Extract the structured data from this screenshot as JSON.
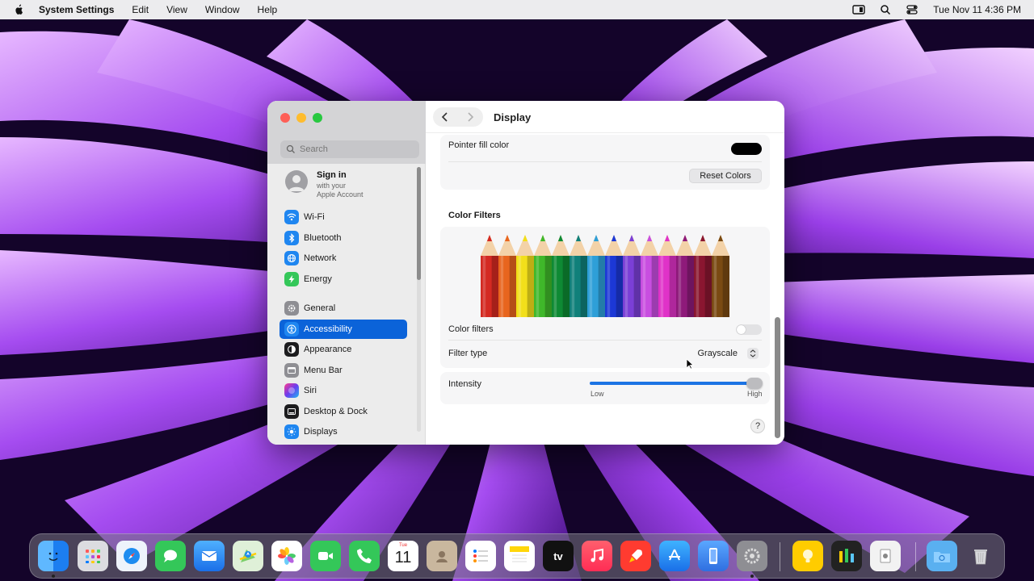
{
  "menubar": {
    "app_name": "System Settings",
    "menus": [
      "Edit",
      "View",
      "Window",
      "Help"
    ],
    "clock": "Tue Nov 11  4:36 PM",
    "status_icons": [
      "display-mirror-icon",
      "search-icon",
      "control-center-icon"
    ]
  },
  "window": {
    "sidebar": {
      "search_placeholder": "Search",
      "account": {
        "title": "Sign in",
        "subtitle_line1": "with your",
        "subtitle_line2": "Apple Account"
      },
      "items": [
        {
          "label": "Wi-Fi",
          "icon": "wifi-icon",
          "color": "#1f86f0"
        },
        {
          "label": "Bluetooth",
          "icon": "bluetooth-icon",
          "color": "#1f86f0"
        },
        {
          "label": "Network",
          "icon": "globe-icon",
          "color": "#1f86f0"
        },
        {
          "label": "Energy",
          "icon": "bolt-icon",
          "color": "#34c759"
        },
        {
          "label": "General",
          "icon": "gear-icon",
          "color": "#8e8e93"
        },
        {
          "label": "Accessibility",
          "icon": "accessibility-icon",
          "color": "#1f86f0",
          "selected": true
        },
        {
          "label": "Appearance",
          "icon": "appearance-icon",
          "color": "#1c1c1e"
        },
        {
          "label": "Menu Bar",
          "icon": "menubar-icon",
          "color": "#8e8e93"
        },
        {
          "label": "Siri",
          "icon": "siri-icon",
          "color": "#6a3df0"
        },
        {
          "label": "Desktop & Dock",
          "icon": "dock-icon",
          "color": "#1c1c1e"
        },
        {
          "label": "Displays",
          "icon": "sun-icon",
          "color": "#1f86f0"
        }
      ]
    },
    "content": {
      "title": "Display",
      "pointer_fill_label": "Pointer fill color",
      "pointer_fill_color": "#000000",
      "reset_button": "Reset Colors",
      "color_filters_section": "Color Filters",
      "color_filters_toggle_label": "Color filters",
      "color_filters_enabled": false,
      "filter_type_label": "Filter type",
      "filter_type_value": "Grayscale",
      "intensity_label": "Intensity",
      "intensity_low": "Low",
      "intensity_high": "High",
      "intensity_value": 1.0,
      "help_label": "?"
    }
  },
  "pencil_colors": [
    "#d42a22",
    "#e8651e",
    "#f2df1a",
    "#3fb82a",
    "#0e8a34",
    "#10807a",
    "#2e9fd8",
    "#1c38d6",
    "#7b3fd6",
    "#c84ee0",
    "#e032c8",
    "#8e1a7a",
    "#8a1630",
    "#7a4a12"
  ],
  "dock": {
    "calendar_month": "Tue",
    "calendar_day": "11",
    "tv_label": "tv",
    "apps": [
      {
        "name": "Finder",
        "icon": "finder-icon"
      },
      {
        "name": "Launchpad",
        "icon": "launchpad-icon"
      },
      {
        "name": "Safari",
        "icon": "safari-icon"
      },
      {
        "name": "Messages",
        "icon": "messages-icon"
      },
      {
        "name": "Mail",
        "icon": "mail-icon"
      },
      {
        "name": "Maps",
        "icon": "maps-icon"
      },
      {
        "name": "Photos",
        "icon": "photos-icon"
      },
      {
        "name": "FaceTime",
        "icon": "facetime-icon"
      },
      {
        "name": "Phone",
        "icon": "phone-icon"
      },
      {
        "name": "Calendar",
        "icon": "calendar-icon"
      },
      {
        "name": "Contacts",
        "icon": "contacts-icon"
      },
      {
        "name": "Reminders",
        "icon": "reminders-icon"
      },
      {
        "name": "Notes",
        "icon": "notes-icon"
      },
      {
        "name": "TV",
        "icon": "tv-icon"
      },
      {
        "name": "Music",
        "icon": "music-icon"
      },
      {
        "name": "Rocket",
        "icon": "rocket-icon"
      },
      {
        "name": "App Store",
        "icon": "appstore-icon"
      },
      {
        "name": "iPhone Mirroring",
        "icon": "iphone-icon"
      },
      {
        "name": "System Settings",
        "icon": "settings-icon"
      },
      {
        "name": "Tips",
        "icon": "tips-icon"
      },
      {
        "name": "Chart App",
        "icon": "chart-app-icon"
      },
      {
        "name": "Preview",
        "icon": "preview-icon"
      },
      {
        "name": "Downloads",
        "icon": "folder-icon"
      },
      {
        "name": "Trash",
        "icon": "trash-icon"
      }
    ]
  }
}
